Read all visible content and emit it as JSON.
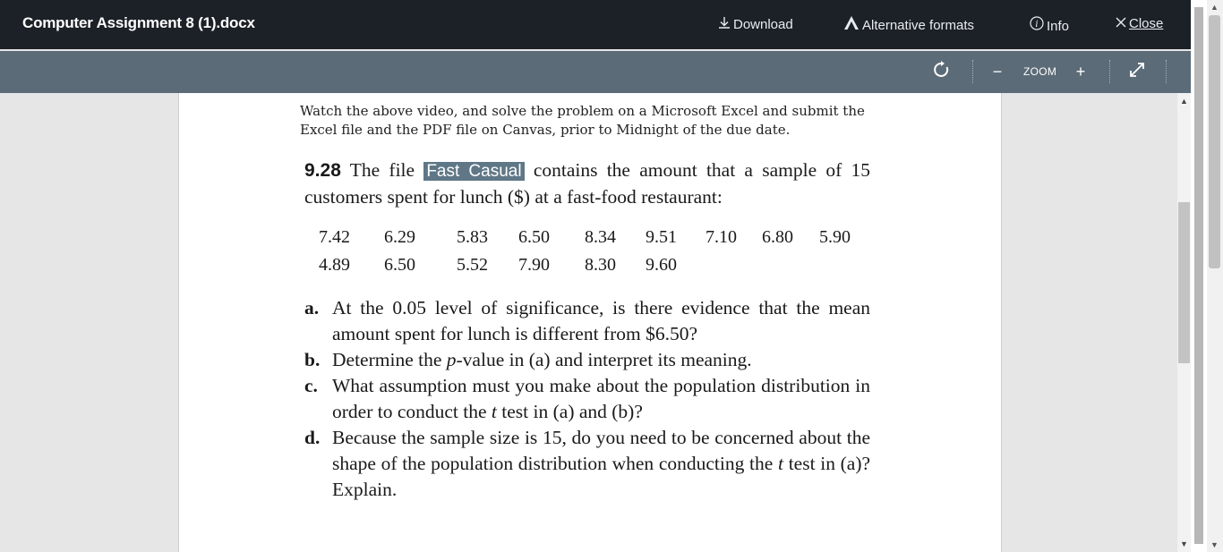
{
  "header": {
    "title": "Computer Assignment 8 (1).docx",
    "download_label": "Download",
    "altformats_label": "Alternative formats",
    "info_label": "Info",
    "close_label": "Close"
  },
  "toolbar": {
    "zoom_label": "ZOOM",
    "zoom_out": "−",
    "zoom_in": "+"
  },
  "document": {
    "intro": "Watch the above video, and solve the problem on a Microsoft Excel and submit the Excel file and the PDF file on Canvas, prior to Midnight of the due date.",
    "problem_number": "9.28",
    "problem_pre": "The file",
    "dataset_name": "Fast Casual",
    "problem_post": "contains the amount that a sample of 15 customers spent for lunch ($) at a fast-food restaurant:",
    "data_row1": [
      "7.42",
      "6.29",
      "5.83",
      "6.50",
      "8.34",
      "9.51",
      "7.10",
      "6.80",
      "5.90"
    ],
    "data_row2": [
      "4.89",
      "6.50",
      "5.52",
      "7.90",
      "8.30",
      "9.60"
    ],
    "parts": {
      "a_label": "a.",
      "a_text": "At the 0.05 level of significance, is there evidence that the mean amount spent for lunch is different from $6.50?",
      "b_label": "b.",
      "b_pre": "Determine the",
      "b_ital": "p",
      "b_post": "-value in (a) and interpret its meaning.",
      "c_label": "c.",
      "c_pre": "What assumption must you make about the population distribution in order to conduct the",
      "c_ital": "t",
      "c_post": "test in (a) and (b)?",
      "d_label": "d.",
      "d_pre": "Because the sample size is 15, do you need to be concerned about the shape of the population distribution when conducting the",
      "d_ital": "t",
      "d_post": "test in (a)? Explain."
    }
  }
}
